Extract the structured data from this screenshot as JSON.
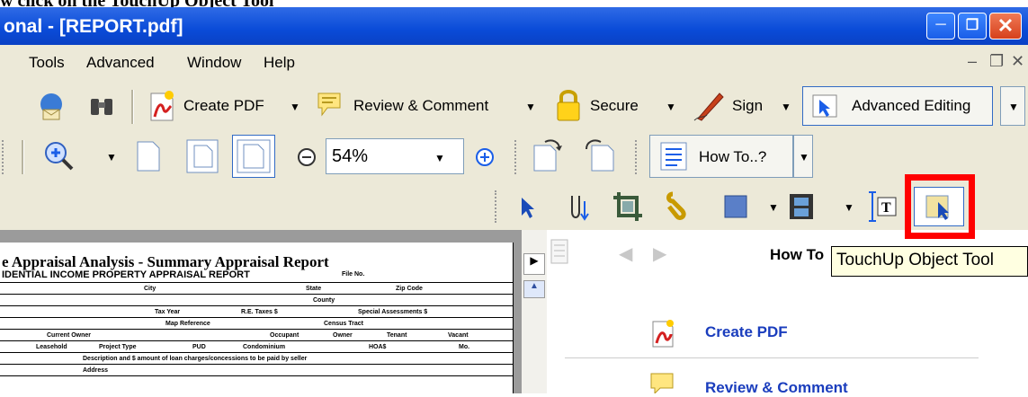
{
  "caption": "w click on the TouchUp Object Tool",
  "window": {
    "title": "onal - [REPORT.pdf]"
  },
  "menu": [
    "Tools",
    "Advanced",
    "Window",
    "Help"
  ],
  "toolbar1": {
    "create_pdf": "Create PDF",
    "review_comment": "Review & Comment",
    "secure": "Secure",
    "sign": "Sign",
    "advanced_editing": "Advanced Editing"
  },
  "toolbar2": {
    "zoom_value": "54%",
    "how_to": "How To..?"
  },
  "document": {
    "heading": "e Appraisal Analysis - Summary Appraisal Report",
    "subheading": "IDENTIAL INCOME PROPERTY APPRAISAL REPORT",
    "file_no": "File No.",
    "city": "City",
    "state": "State",
    "zip": "Zip Code",
    "county": "County",
    "tax_year": "Tax Year",
    "re_taxes": "R.E. Taxes $",
    "special": "Special Assessments $",
    "map_ref": "Map Reference",
    "census": "Census Tract",
    "current_owner": "Current Owner",
    "occupant": "Occupant",
    "owner": "Owner",
    "tenant": "Tenant",
    "vacant": "Vacant",
    "leasehold": "Leasehold",
    "project_type": "Project Type",
    "pud": "PUD",
    "condo": "Condominium",
    "hoa": "HOA$",
    "mo": "Mo.",
    "description": "Description and $ amount of loan charges/concessions to be paid by seller",
    "address": "Address"
  },
  "howto_pane": {
    "title": "How To",
    "links": [
      "Create PDF",
      "Review & Comment"
    ]
  },
  "tooltip": "TouchUp Object Tool"
}
